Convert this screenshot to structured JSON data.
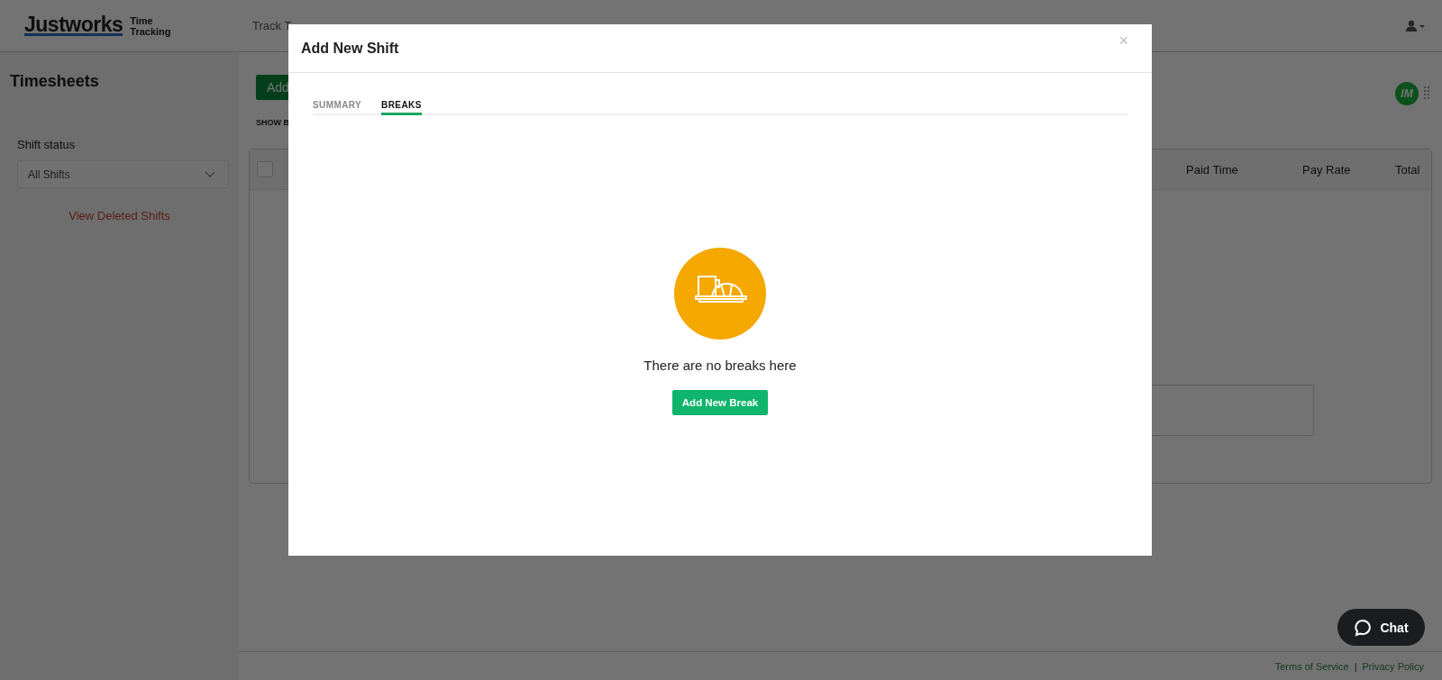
{
  "header": {
    "logo": "Justworks",
    "logo_sub": "Time Tracking",
    "nav": [
      "Track T"
    ]
  },
  "sidebar": {
    "title": "Timesheets",
    "filter_label": "Shift status",
    "filter_value": "All Shifts",
    "link": "View Deleted Shifts"
  },
  "main": {
    "add_button": "Add",
    "show_label": "SHOW B",
    "table": {
      "select_all_checked": false,
      "columns": [
        "Paid Time",
        "Pay Rate",
        "Total"
      ]
    }
  },
  "badge": "IM",
  "modal": {
    "title": "Add New Shift",
    "close": "×",
    "tabs": [
      {
        "label": "SUMMARY",
        "selected": false
      },
      {
        "label": "BREAKS",
        "selected": true
      }
    ],
    "empty_message": "There are no breaks here",
    "button": "Add New Break"
  },
  "chat": "Chat",
  "footer": {
    "links": [
      "Terms of Service",
      "Privacy Policy"
    ],
    "separator": "|"
  }
}
